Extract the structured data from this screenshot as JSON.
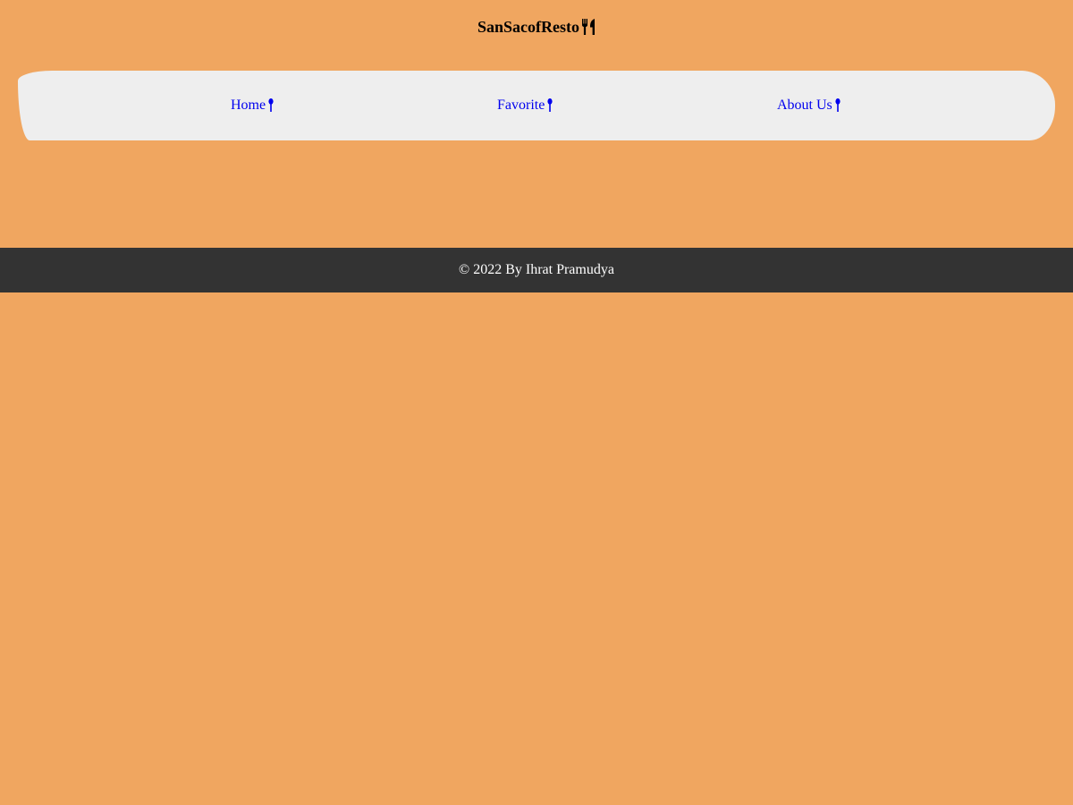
{
  "header": {
    "brand": "SanSacofResto",
    "brand_icon": "utensils-icon"
  },
  "nav": {
    "items": [
      {
        "label": "Home",
        "icon": "spoon-icon"
      },
      {
        "label": "Favorite",
        "icon": "spoon-icon"
      },
      {
        "label": "About Us",
        "icon": "spoon-icon"
      }
    ]
  },
  "footer": {
    "text": "© 2022 By Ihrat Pramudya"
  },
  "colors": {
    "page_background": "#F0A660",
    "nav_background": "#EEEEEE",
    "link": "#0000EE",
    "footer_background": "#333333",
    "footer_text": "#FFFFFF"
  }
}
